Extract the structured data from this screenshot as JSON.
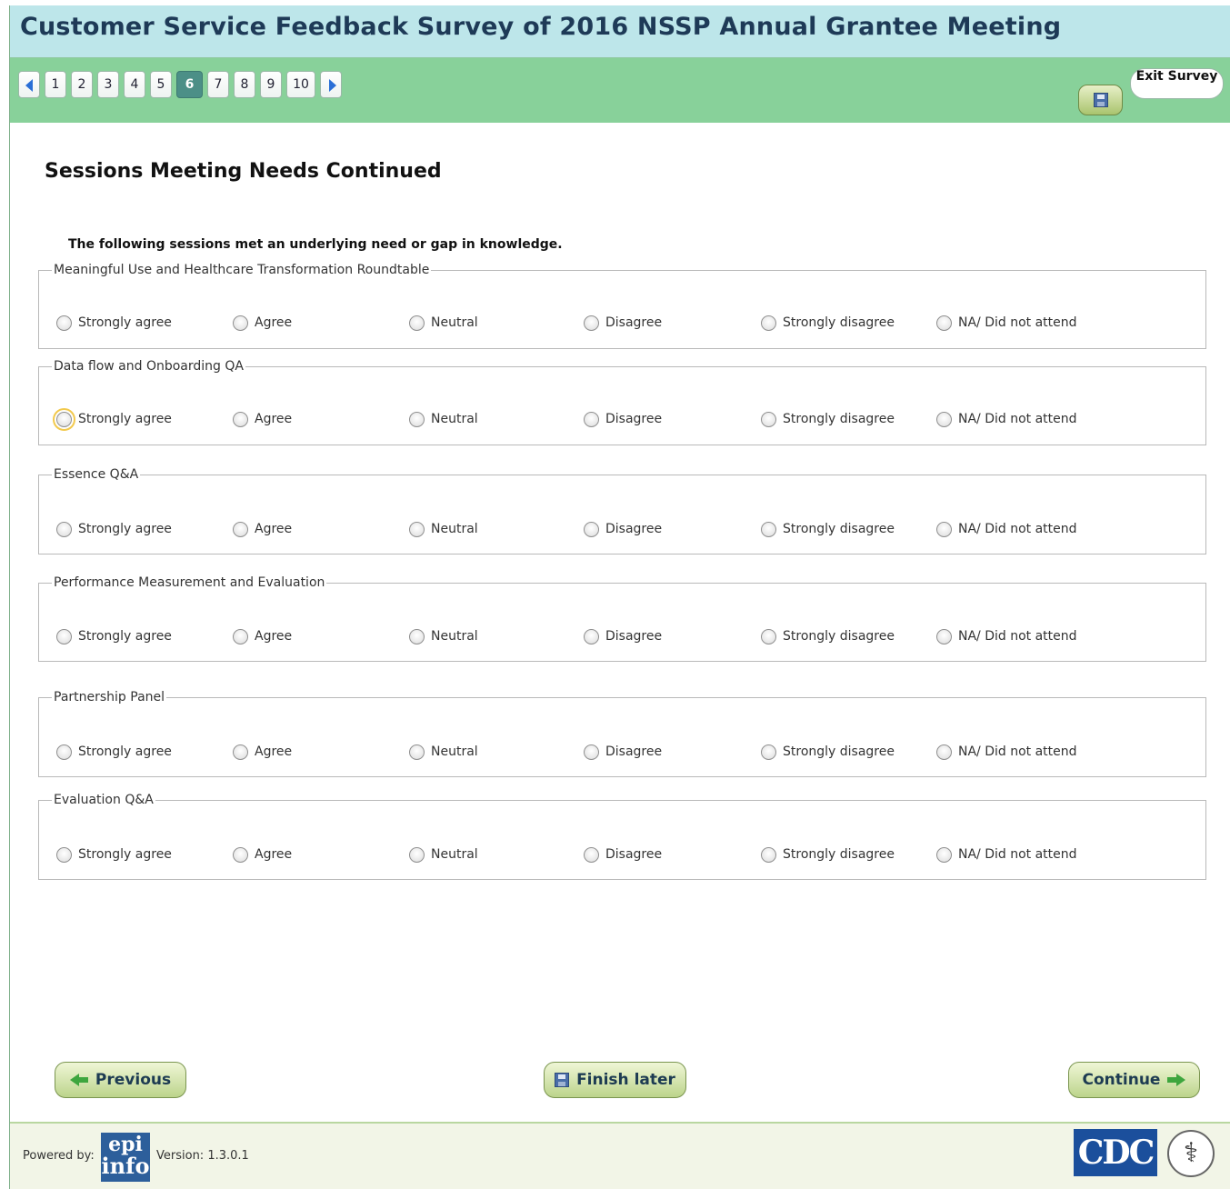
{
  "header": {
    "title": "Customer Service Feedback Survey of 2016 NSSP Annual Grantee Meeting"
  },
  "nav": {
    "pages": [
      "1",
      "2",
      "3",
      "4",
      "5",
      "6",
      "7",
      "8",
      "9",
      "10"
    ],
    "current_page": "6",
    "exit_label": "Exit Survey"
  },
  "page": {
    "title": "Sessions Meeting Needs Continued",
    "question": "The following sessions met an underlying need or gap in knowledge."
  },
  "options": [
    "Strongly agree",
    "Agree",
    "Neutral",
    "Disagree",
    "Strongly disagree",
    "NA/ Did not attend"
  ],
  "groups": [
    {
      "label": "Meaningful Use and Healthcare Transformation Roundtable"
    },
    {
      "label": "Data flow and Onboarding QA"
    },
    {
      "label": "Essence Q&A"
    },
    {
      "label": "Performance Measurement and Evaluation"
    },
    {
      "label": "Partnership Panel"
    },
    {
      "label": "Evaluation Q&A"
    }
  ],
  "buttons": {
    "previous": "Previous",
    "finish_later": "Finish later",
    "continue": "Continue"
  },
  "footer": {
    "powered_by": "Powered by:",
    "epi_top": "epi",
    "epi_bottom": "info",
    "version": "Version: 1.3.0.1",
    "cdc_logo": "CDC"
  },
  "colors": {
    "title_bg": "#bde6ea",
    "nav_bg": "#88d19a",
    "active_page": "#4c8f87",
    "button_green": "#bcd48b"
  }
}
